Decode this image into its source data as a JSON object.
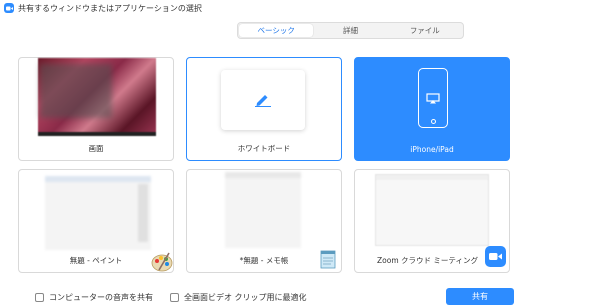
{
  "window": {
    "title": "共有するウィンドウまたはアプリケーションの選択",
    "icon": "zoom-app-icon"
  },
  "tabs": [
    {
      "label": "ベーシック",
      "active": true
    },
    {
      "label": "詳細",
      "active": false
    },
    {
      "label": "ファイル",
      "active": false
    }
  ],
  "cards": [
    {
      "label": "画面",
      "icon": "desktop-thumbnail",
      "state": "normal"
    },
    {
      "label": "ホワイトボード",
      "icon": "pen-icon",
      "state": "selected"
    },
    {
      "label": "iPhone/iPad",
      "icon": "iphone-airplay-icon",
      "state": "active"
    },
    {
      "label": "無題 - ペイント",
      "icon": "paint-icon",
      "state": "normal"
    },
    {
      "label": "*無題 - メモ帳",
      "icon": "notepad-icon",
      "state": "normal"
    },
    {
      "label": "Zoom クラウド ミーティング",
      "icon": "zoom-camera-icon",
      "state": "normal"
    }
  ],
  "footer": {
    "share_audio_label": "コンピューターの音声を共有",
    "optimize_video_label": "全画面ビデオ クリップ用に最適化",
    "share_button_label": "共有"
  },
  "colors": {
    "accent": "#2d8cff",
    "active_tab_text": "#1a73e8"
  }
}
